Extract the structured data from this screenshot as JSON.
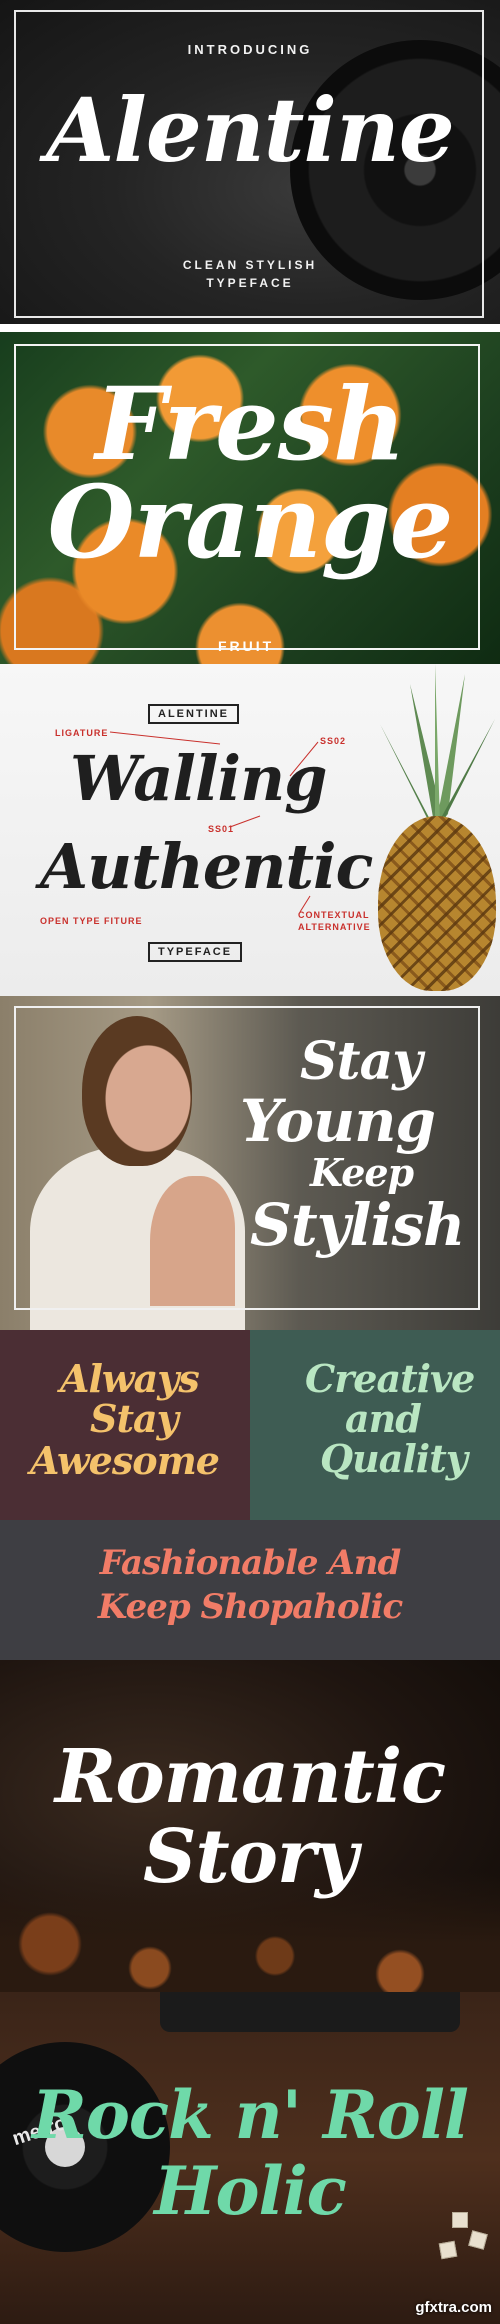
{
  "panel1": {
    "intro": "INTRODUCING",
    "title": "Alentine",
    "subtitle_line1": "CLEAN STYLISH",
    "subtitle_line2": "TYPEFACE"
  },
  "panel2": {
    "line1": "Fresh",
    "line2": "Orange",
    "caption": "FRUIT"
  },
  "panel3": {
    "tag_top": "ALENTINE",
    "tag_bottom": "TYPEFACE",
    "word1": "Walling",
    "word2": "Authentic",
    "ligature": "LIGATURE",
    "ss02": "SS02",
    "ss01": "SS01",
    "open_type": "OPEN TYPE FITURE",
    "contextual_1": "CONTEXTUAL",
    "contextual_2": "ALTERNATIVE"
  },
  "panel4": {
    "line1": "Stay",
    "line2": "Young",
    "line3": "Keep",
    "line4": "Stylish"
  },
  "panel5": {
    "left": {
      "line1": "Always",
      "line2": "Stay",
      "line3": "Awesome"
    },
    "right": {
      "line1": "Creative",
      "line2": "and",
      "line3": "Quality"
    }
  },
  "panel6": {
    "line1": "Fashionable And",
    "line2": "Keep Shopaholic"
  },
  "panel7": {
    "line1": "Romantic",
    "line2": "Story"
  },
  "panel8": {
    "line1": "Rock n' Roll",
    "line2": "Holic",
    "record_label": "metro",
    "watermark": "gfxtra.com"
  },
  "colors": {
    "script_white": "#ffffff",
    "always_yellow": "#f4c26b",
    "creative_mint": "#b9e6c2",
    "fashion_coral": "#f17c67",
    "rock_green": "#6fd9a9",
    "annotation_red": "#c9302c"
  }
}
